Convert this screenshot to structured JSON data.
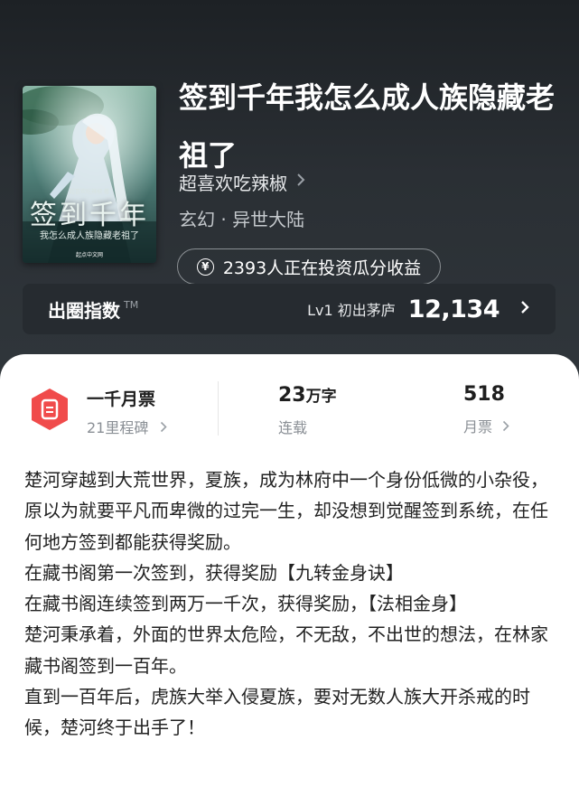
{
  "book": {
    "title": "签到千年我怎么成人族隐藏老祖了",
    "author": "超喜欢吃辣椒",
    "genre": "玄幻 · 异世大陆",
    "cover": {
      "title": "签到千年",
      "subtitle": "我怎么成人族隐藏老祖了",
      "author": "超喜欢吃辣椒 著",
      "publisher": "起点中文网"
    }
  },
  "invest": {
    "text": "2393人正在投资瓜分收益",
    "icon": "yen-icon"
  },
  "index": {
    "label": "出圈指数",
    "tm": "TM",
    "level": "Lv1 初出茅庐",
    "value": "12,134",
    "icon": "chevron-right-icon"
  },
  "stats": {
    "ticket": {
      "title": "一千月票",
      "subtitle": "21里程碑",
      "icon": "ticket-icon",
      "color": "#f04b4b"
    },
    "words": {
      "value": "23",
      "unit": "万字",
      "label": "连载"
    },
    "votes": {
      "value": "518",
      "label": "月票"
    }
  },
  "synopsis": [
    "楚河穿越到大荒世界，夏族，成为林府中一个身份低微的小杂役，原以为就要平凡而卑微的过完一生，却没想到觉醒签到系统，在任何地方签到都能获得奖励。",
    "在藏书阁第一次签到，获得奖励【九转金身诀】",
    "在藏书阁连续签到两万一千次，获得奖励，【法相金身】",
    "楚河秉承着，外面的世界太危险，不无敌，不出世的想法，在林家藏书阁签到一百年。",
    "直到一百年后，虎族大举入侵夏族，要对无数人族大开杀戒的时候，楚河终于出手了！"
  ],
  "colors": {
    "background": "#2c3136",
    "sheet": "#ffffff",
    "accent": "#f04b4b"
  }
}
